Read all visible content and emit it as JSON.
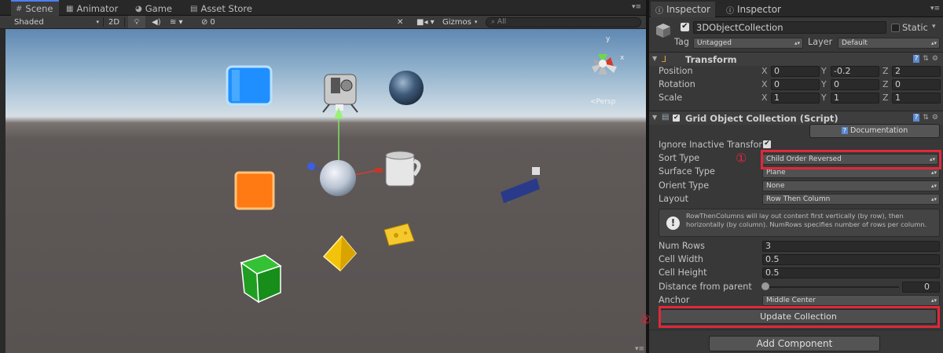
{
  "scene_tabs": [
    {
      "label": "Scene",
      "icon": "grid-icon",
      "active": true
    },
    {
      "label": "Animator",
      "icon": "animator-icon",
      "active": false
    },
    {
      "label": "Game",
      "icon": "pacman-icon",
      "active": false
    },
    {
      "label": "Asset Store",
      "icon": "store-icon",
      "active": false
    }
  ],
  "scene_toolbar": {
    "shading": "Shaded",
    "mode_2d": "2D",
    "effects_count": "0",
    "gizmos": "Gizmos",
    "search_placeholder": "All"
  },
  "gizmo": {
    "x": "x",
    "y": "y",
    "view": "<Persp"
  },
  "inspector_tabs": [
    {
      "label": "Inspector",
      "active": true
    },
    {
      "label": "Inspector",
      "active": false
    }
  ],
  "object": {
    "name": "3DObjectCollection",
    "static_label": "Static",
    "tag_label": "Tag",
    "tag_value": "Untagged",
    "layer_label": "Layer",
    "layer_value": "Default"
  },
  "transform": {
    "title": "Transform",
    "rows": [
      {
        "label": "Position",
        "x": "0",
        "y": "-0.2",
        "z": "2"
      },
      {
        "label": "Rotation",
        "x": "0",
        "y": "0",
        "z": "0"
      },
      {
        "label": "Scale",
        "x": "1",
        "y": "1",
        "z": "1"
      }
    ],
    "axis": {
      "x": "X",
      "y": "Y",
      "z": "Z"
    }
  },
  "grid_collection": {
    "title": "Grid Object Collection (Script)",
    "documentation": "Documentation",
    "ignore_inactive": "Ignore Inactive Transfor",
    "sort_type_label": "Sort Type",
    "sort_type_value": "Child Order Reversed",
    "surface_type_label": "Surface Type",
    "surface_type_value": "Plane",
    "orient_type_label": "Orient Type",
    "orient_type_value": "None",
    "layout_label": "Layout",
    "layout_value": "Row Then Column",
    "help_text": "RowThenColumns will lay out content first vertically (by row), then horizontally (by column). NumRows specifies number of rows per column.",
    "num_rows_label": "Num Rows",
    "num_rows_value": "3",
    "cell_width_label": "Cell Width",
    "cell_width_value": "0.5",
    "cell_height_label": "Cell Height",
    "cell_height_value": "0.5",
    "distance_label": "Distance from parent",
    "distance_value": "0",
    "anchor_label": "Anchor",
    "anchor_value": "Middle Center",
    "update_button": "Update Collection"
  },
  "add_component": "Add Component",
  "annotations": {
    "one": "①",
    "two": "②"
  },
  "colors": {
    "highlight": "#e0283a",
    "tab_accent": "#4c7fff"
  }
}
